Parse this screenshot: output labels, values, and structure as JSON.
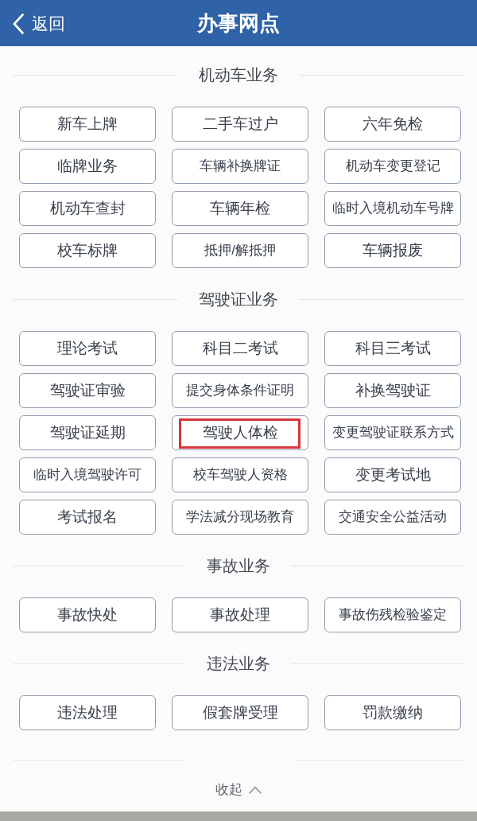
{
  "header": {
    "back_label": "返回",
    "title": "办事网点"
  },
  "sections": [
    {
      "title": "机动车业务",
      "items": [
        {
          "label": "新车上牌",
          "highlighted": false
        },
        {
          "label": "二手车过户",
          "highlighted": false
        },
        {
          "label": "六年免检",
          "highlighted": false
        },
        {
          "label": "临牌业务",
          "highlighted": false
        },
        {
          "label": "车辆补换牌证",
          "highlighted": false
        },
        {
          "label": "机动车变更登记",
          "highlighted": false
        },
        {
          "label": "机动车查封",
          "highlighted": false
        },
        {
          "label": "车辆年检",
          "highlighted": false
        },
        {
          "label": "临时入境机动车号牌",
          "highlighted": false
        },
        {
          "label": "校车标牌",
          "highlighted": false
        },
        {
          "label": "抵押/解抵押",
          "highlighted": false
        },
        {
          "label": "车辆报废",
          "highlighted": false
        }
      ]
    },
    {
      "title": "驾驶证业务",
      "items": [
        {
          "label": "理论考试",
          "highlighted": false
        },
        {
          "label": "科目二考试",
          "highlighted": false
        },
        {
          "label": "科目三考试",
          "highlighted": false
        },
        {
          "label": "驾驶证审验",
          "highlighted": false
        },
        {
          "label": "提交身体条件证明",
          "highlighted": false
        },
        {
          "label": "补换驾驶证",
          "highlighted": false
        },
        {
          "label": "驾驶证延期",
          "highlighted": false
        },
        {
          "label": "驾驶人体检",
          "highlighted": true
        },
        {
          "label": "变更驾驶证联系方式",
          "highlighted": false
        },
        {
          "label": "临时入境驾驶许可",
          "highlighted": false
        },
        {
          "label": "校车驾驶人资格",
          "highlighted": false
        },
        {
          "label": "变更考试地",
          "highlighted": false
        },
        {
          "label": "考试报名",
          "highlighted": false
        },
        {
          "label": "学法减分现场教育",
          "highlighted": false
        },
        {
          "label": "交通安全公益活动",
          "highlighted": false
        }
      ]
    },
    {
      "title": "事故业务",
      "items": [
        {
          "label": "事故快处",
          "highlighted": false
        },
        {
          "label": "事故处理",
          "highlighted": false
        },
        {
          "label": "事故伤残检验鉴定",
          "highlighted": false
        }
      ]
    },
    {
      "title": "违法业务",
      "items": [
        {
          "label": "违法处理",
          "highlighted": false
        },
        {
          "label": "假套牌受理",
          "highlighted": false
        },
        {
          "label": "罚款缴纳",
          "highlighted": false
        }
      ]
    }
  ],
  "collapse": {
    "label": "收起"
  }
}
